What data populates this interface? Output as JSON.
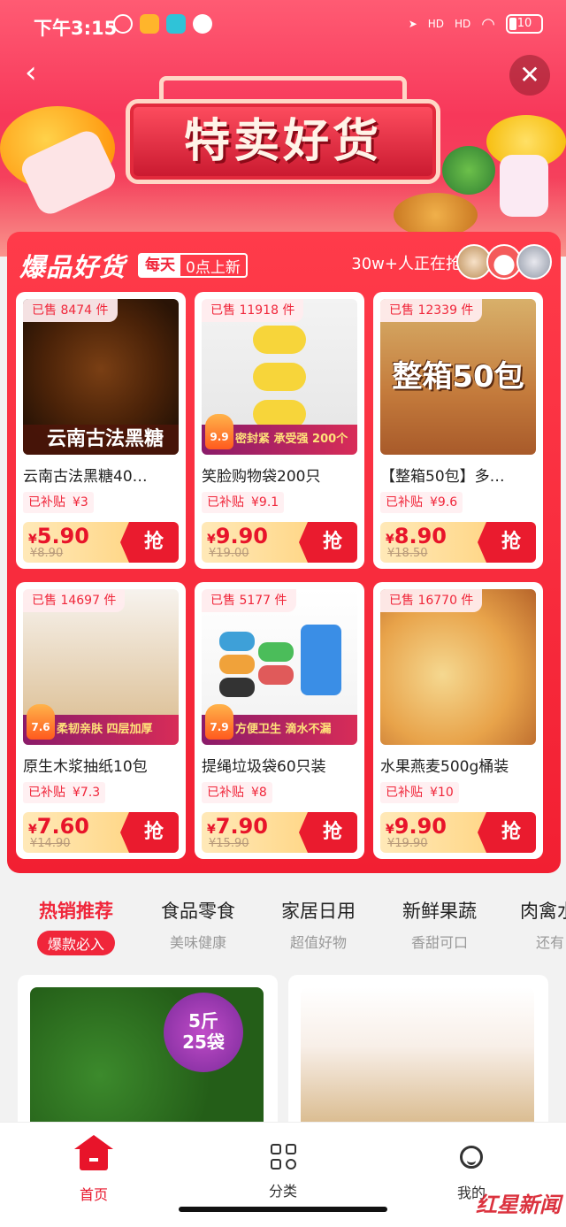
{
  "status_bar": {
    "time": "下午3:15",
    "battery": "10",
    "signal1": "HD",
    "signal2": "HD"
  },
  "hero": {
    "title": "特卖好货"
  },
  "deals": {
    "title": "爆品好货",
    "tag_a": "每天",
    "tag_b": "0点上新",
    "rush_text": "30w+人正在抢",
    "products": [
      {
        "sold": "已售 8474 件",
        "name": "云南古法黑糖40…",
        "subsidy_label": "已补贴",
        "subsidy": "¥3",
        "price": "5.90",
        "original": "¥8.90",
        "caption": "云南古法黑糖",
        "badge": "",
        "grab": "抢"
      },
      {
        "sold": "已售 11918 件",
        "name": "笑脸购物袋200只",
        "subsidy_label": "已补贴",
        "subsidy": "¥9.1",
        "price": "9.90",
        "original": "¥19.00",
        "caption": "密封紧 承受强 200个",
        "badge": "9.9",
        "grab": "抢"
      },
      {
        "sold": "已售 12339 件",
        "name": "【整箱50包】多…",
        "subsidy_label": "已补贴",
        "subsidy": "¥9.6",
        "price": "8.90",
        "original": "¥18.50",
        "caption": "整箱50包",
        "badge": "",
        "grab": "抢"
      },
      {
        "sold": "已售 14697 件",
        "name": "原生木浆抽纸10包",
        "subsidy_label": "已补贴",
        "subsidy": "¥7.3",
        "price": "7.60",
        "original": "¥14.90",
        "caption": "柔韧亲肤 四层加厚",
        "badge": "7.6",
        "grab": "抢"
      },
      {
        "sold": "已售 5177 件",
        "name": "提绳垃圾袋60只装",
        "subsidy_label": "已补贴",
        "subsidy": "¥8",
        "price": "7.90",
        "original": "¥15.90",
        "caption": "方便卫生 滴水不漏",
        "badge": "7.9",
        "grab": "抢"
      },
      {
        "sold": "已售 16770 件",
        "name": "水果燕麦500g桶装",
        "subsidy_label": "已补贴",
        "subsidy": "¥10",
        "price": "9.90",
        "original": "¥19.90",
        "caption": "",
        "badge": "",
        "grab": "抢"
      }
    ]
  },
  "tabs": [
    {
      "label": "热销推荐",
      "sub": "爆款必入",
      "active": true
    },
    {
      "label": "食品零食",
      "sub": "美味健康"
    },
    {
      "label": "家居日用",
      "sub": "超值好物"
    },
    {
      "label": "新鲜果蔬",
      "sub": "香甜可口"
    },
    {
      "label": "肉禽水",
      "sub": "还有"
    }
  ],
  "feed": {
    "promo_badge_1": "5斤",
    "promo_badge_2": "25袋"
  },
  "nav": {
    "home": "首页",
    "category": "分类",
    "me": "我的"
  },
  "watermark": "红星新闻",
  "colors": {
    "accent": "#e8142a",
    "panel": "#f21f32"
  }
}
